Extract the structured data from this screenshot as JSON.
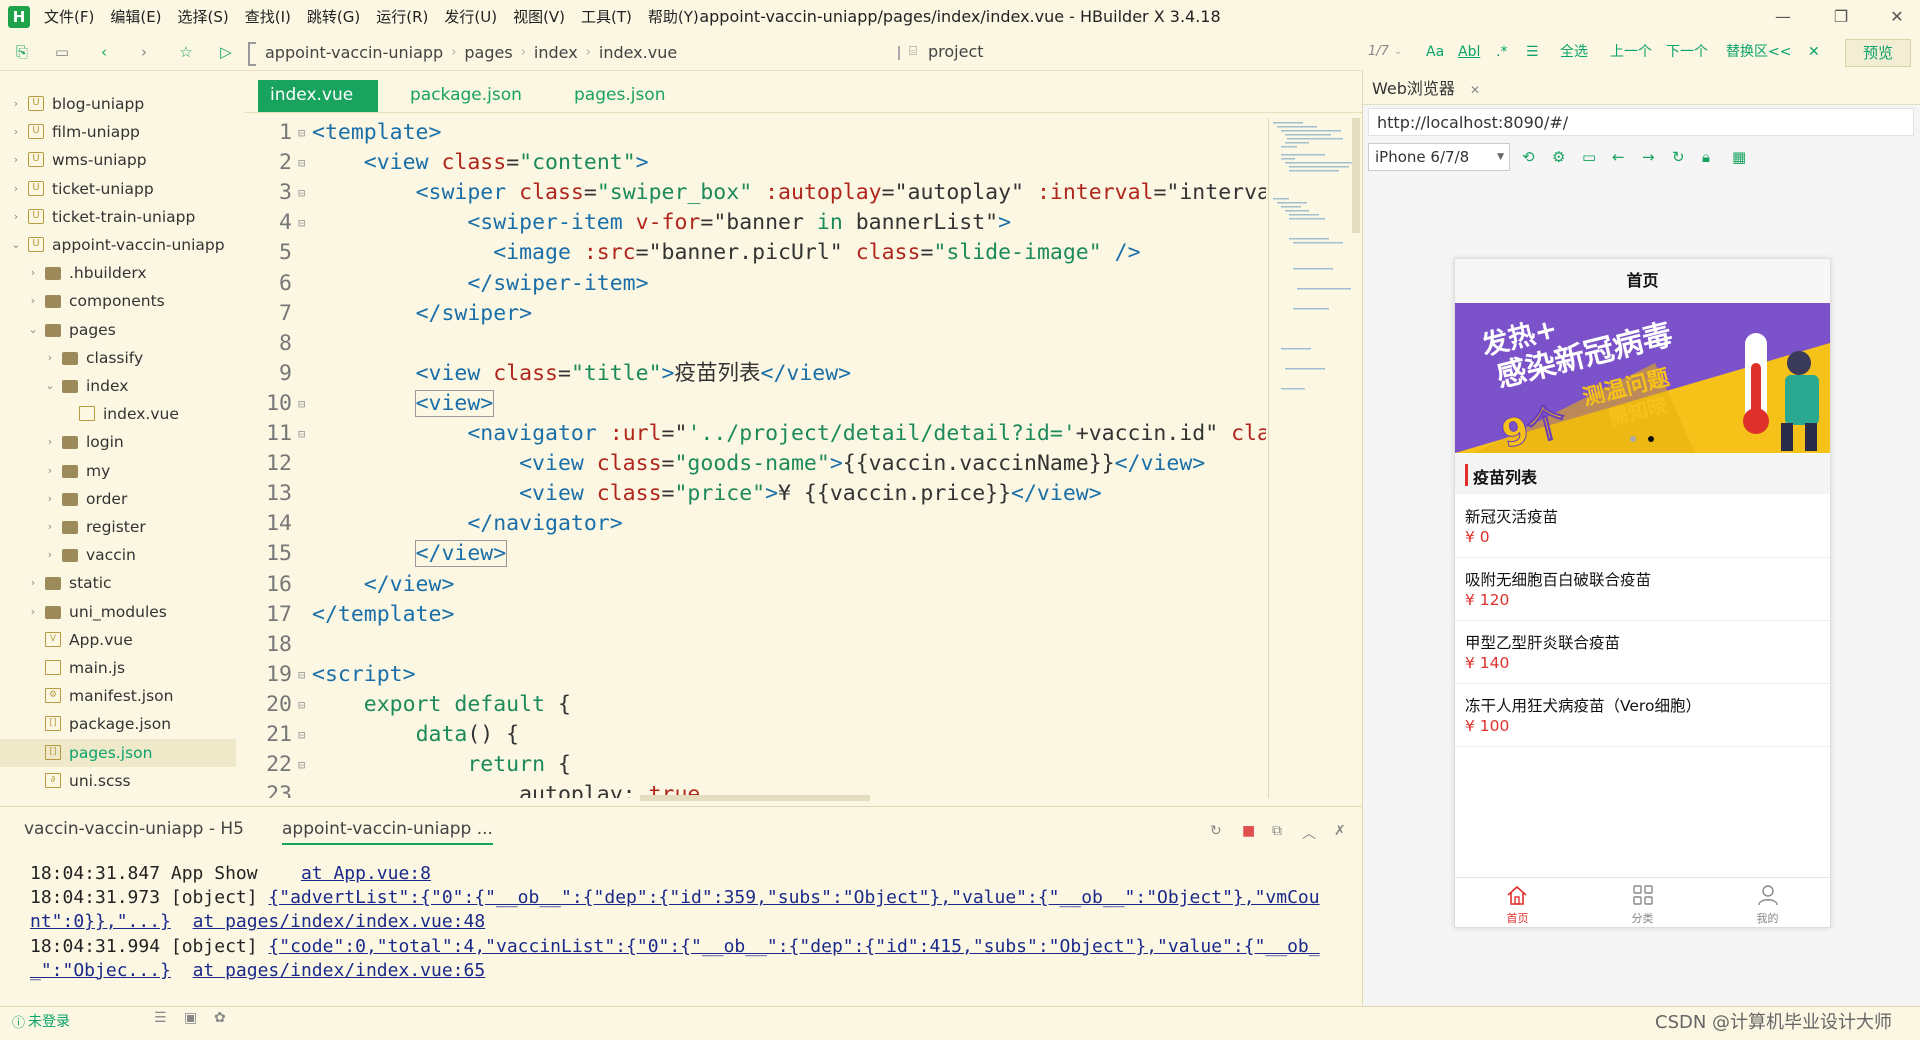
{
  "menu": {
    "items": [
      "文件(F)",
      "编辑(E)",
      "选择(S)",
      "查找(I)",
      "跳转(G)",
      "运行(R)",
      "发行(U)",
      "视图(V)",
      "工具(T)",
      "帮助(Y)"
    ],
    "window_title": "appoint-vaccin-uniapp/pages/index/index.vue - HBuilder X 3.4.18",
    "logo": "H"
  },
  "toolbar": {
    "breadcrumb": [
      "appoint-vaccin-uniapp",
      "pages",
      "index",
      "index.vue"
    ],
    "project": "project",
    "find_counter": "1/7",
    "find_case": "Aa",
    "find_word": "Abl",
    "find_buttons": [
      "全选",
      "上一个",
      "下一个",
      "替换区<<"
    ],
    "preview_label": "预览"
  },
  "sidebar": {
    "items": [
      {
        "label": "blog-uniapp",
        "type": "project",
        "indent": 0,
        "chev": "›"
      },
      {
        "label": "film-uniapp",
        "type": "project",
        "indent": 0,
        "chev": "›"
      },
      {
        "label": "wms-uniapp",
        "type": "project",
        "indent": 0,
        "chev": "›"
      },
      {
        "label": "ticket-uniapp",
        "type": "project",
        "indent": 0,
        "chev": "›"
      },
      {
        "label": "ticket-train-uniapp",
        "type": "project",
        "indent": 0,
        "chev": "›"
      },
      {
        "label": "appoint-vaccin-uniapp",
        "type": "project",
        "indent": 0,
        "chev": "⌄"
      },
      {
        "label": ".hbuilderx",
        "type": "folder",
        "indent": 1,
        "chev": "›"
      },
      {
        "label": "components",
        "type": "folder",
        "indent": 1,
        "chev": "›"
      },
      {
        "label": "pages",
        "type": "folder",
        "indent": 1,
        "chev": "⌄"
      },
      {
        "label": "classify",
        "type": "folder",
        "indent": 2,
        "chev": "›"
      },
      {
        "label": "index",
        "type": "folder",
        "indent": 2,
        "chev": "⌄"
      },
      {
        "label": "index.vue",
        "type": "file",
        "indent": 3,
        "chev": ""
      },
      {
        "label": "login",
        "type": "folder",
        "indent": 2,
        "chev": "›"
      },
      {
        "label": "my",
        "type": "folder",
        "indent": 2,
        "chev": "›"
      },
      {
        "label": "order",
        "type": "folder",
        "indent": 2,
        "chev": "›"
      },
      {
        "label": "register",
        "type": "folder",
        "indent": 2,
        "chev": "›"
      },
      {
        "label": "vaccin",
        "type": "folder",
        "indent": 2,
        "chev": "›"
      },
      {
        "label": "static",
        "type": "folder",
        "indent": 1,
        "chev": "›"
      },
      {
        "label": "uni_modules",
        "type": "folder",
        "indent": 1,
        "chev": "›"
      },
      {
        "label": "App.vue",
        "type": "file",
        "indent": 1,
        "chev": "",
        "glyph": "V"
      },
      {
        "label": "main.js",
        "type": "file",
        "indent": 1,
        "chev": ""
      },
      {
        "label": "manifest.json",
        "type": "file",
        "indent": 1,
        "chev": "",
        "glyph": "⚙"
      },
      {
        "label": "package.json",
        "type": "file",
        "indent": 1,
        "chev": "",
        "glyph": "[]"
      },
      {
        "label": "pages.json",
        "type": "file",
        "indent": 1,
        "chev": "",
        "glyph": "[]",
        "selected": true
      },
      {
        "label": "uni.scss",
        "type": "file",
        "indent": 1,
        "chev": "",
        "glyph": "∂"
      }
    ]
  },
  "editor": {
    "tabs": [
      "index.vue",
      "package.json",
      "pages.json"
    ],
    "active_tab": 0,
    "lines": [
      {
        "n": "1",
        "fold": "⊟",
        "html": "<span class=\"tag\">&lt;template&gt;</span>"
      },
      {
        "n": "2",
        "fold": "⊟",
        "html": "    <span class=\"tag\">&lt;view</span> <span class=\"attr\">class</span>=<span class=\"str\">\"content\"</span><span class=\"tag\">&gt;</span>"
      },
      {
        "n": "3",
        "fold": "⊟",
        "html": "        <span class=\"tag\">&lt;swiper</span> <span class=\"attr\">class</span>=<span class=\"str\">\"swiper_box\"</span> <span class=\"attr\">:autoplay</span>=<span class=\"txt\">\"autoplay\"</span> <span class=\"attr\">:interval</span>=<span class=\"txt\">\"interval\"</span>"
      },
      {
        "n": "4",
        "fold": "⊟",
        "html": "            <span class=\"tag\">&lt;swiper-item</span> <span class=\"attr\">v-for</span>=<span class=\"txt\">\"banner <span class=\"kw\">in</span> bannerList\"</span><span class=\"tag\">&gt;</span>"
      },
      {
        "n": "5",
        "fold": "",
        "html": "              <span class=\"tag\">&lt;image</span> <span class=\"attr\">:src</span>=<span class=\"txt\">\"banner.picUrl\"</span> <span class=\"attr\">class</span>=<span class=\"str\">\"slide-image\"</span> <span class=\"tag\">/&gt;</span>"
      },
      {
        "n": "6",
        "fold": "",
        "html": "            <span class=\"tag\">&lt;/swiper-item&gt;</span>"
      },
      {
        "n": "7",
        "fold": "",
        "html": "        <span class=\"tag\">&lt;/swiper&gt;</span>"
      },
      {
        "n": "8",
        "fold": "",
        "html": ""
      },
      {
        "n": "9",
        "fold": "",
        "html": "        <span class=\"tag\">&lt;view</span> <span class=\"attr\">class</span>=<span class=\"str\">\"title\"</span><span class=\"tag\">&gt;</span><span class=\"txt\">疫苗列表</span><span class=\"tag\">&lt;/view&gt;</span>"
      },
      {
        "n": "10",
        "fold": "⊟",
        "html": "        <span class=\"tag bracket-hl\">&lt;view&gt;</span>"
      },
      {
        "n": "11",
        "fold": "⊟",
        "html": "            <span class=\"tag\">&lt;navigator</span> <span class=\"attr\">:url</span>=<span class=\"txt\">\"<span class=\"str\">'../project/detail/detail?id='</span>+vaccin.id\"</span> <span class=\"attr\">class</span>"
      },
      {
        "n": "12",
        "fold": "",
        "html": "                <span class=\"tag\">&lt;view</span> <span class=\"attr\">class</span>=<span class=\"str\">\"goods-name\"</span><span class=\"tag\">&gt;</span><span class=\"txt\">{{vaccin.vaccinName}}</span><span class=\"tag\">&lt;/view&gt;</span>"
      },
      {
        "n": "13",
        "fold": "",
        "html": "                <span class=\"tag\">&lt;view</span> <span class=\"attr\">class</span>=<span class=\"str\">\"price\"</span><span class=\"tag\">&gt;</span><span class=\"txt\">¥ {{vaccin.price}}</span><span class=\"tag\">&lt;/view&gt;</span>"
      },
      {
        "n": "14",
        "fold": "",
        "html": "            <span class=\"tag\">&lt;/navigator&gt;</span>"
      },
      {
        "n": "15",
        "fold": "",
        "html": "        <span class=\"tag bracket-hl\">&lt;/view&gt;</span>"
      },
      {
        "n": "16",
        "fold": "",
        "html": "    <span class=\"tag\">&lt;/view&gt;</span>"
      },
      {
        "n": "17",
        "fold": "",
        "html": "<span class=\"tag\">&lt;/template&gt;</span>"
      },
      {
        "n": "18",
        "fold": "",
        "html": ""
      },
      {
        "n": "19",
        "fold": "⊟",
        "html": "<span class=\"tag\">&lt;script&gt;</span>"
      },
      {
        "n": "20",
        "fold": "⊟",
        "html": "    <span class=\"kw\">export default</span> <span class=\"txt\">{</span>"
      },
      {
        "n": "21",
        "fold": "⊟",
        "html": "        <span class=\"kw\">data</span><span class=\"txt\">() {</span>"
      },
      {
        "n": "22",
        "fold": "⊟",
        "html": "            <span class=\"kw\">return</span> <span class=\"txt\">{</span>"
      },
      {
        "n": "23",
        "fold": "",
        "html": "                <span class=\"txt\">autoplay: </span><span class=\"attr\">true</span><span class=\"txt\">,</span>"
      }
    ]
  },
  "console": {
    "tabs": [
      "vaccin-vaccin-uniapp - H5",
      "appoint-vaccin-uniapp ..."
    ],
    "logs": [
      {
        "text": "18:04:31.847 App Show  ",
        "link1": "",
        "link2": "at App.vue:8"
      },
      {
        "text": "18:04:31.973 [object] ",
        "link1": "{\"advertList\":{\"0\":{\"__ob__\":{\"dep\":{\"id\":359,\"subs\":\"Object\"},\"value\":{\"__ob__\":\"Object\"},\"vmCou",
        "link2": ""
      },
      {
        "text": "",
        "link1": "nt\":0}},\"...}",
        "link2": "  at pages/index/index.vue:48"
      },
      {
        "text": "18:04:31.994 [object] ",
        "link1": "{\"code\":0,\"total\":4,\"vaccinList\":{\"0\":{\"__ob__\":{\"dep\":{\"id\":415,\"subs\":\"Object\"},\"value\":{\"__ob_",
        "link2": ""
      },
      {
        "text": "",
        "link1": "_\":\"Objec...}",
        "link2": "  at pages/index/index.vue:65"
      }
    ]
  },
  "status": {
    "login": "未登录",
    "watermark": "CSDN @计算机毕业设计大师"
  },
  "browser": {
    "tab_label": "Web浏览器",
    "url": "http://localhost:8090/#/",
    "device": "iPhone 6/7/8"
  },
  "phone": {
    "nav_title": "首页",
    "banner_line1": "发热+",
    "banner_line2": "感染新冠病毒",
    "banner_big": "9个",
    "banner_line3": "测温问题",
    "banner_line4": "需知晓",
    "section_title": "疫苗列表",
    "vaccines": [
      {
        "name": "新冠灭活疫苗",
        "price": "¥ 0"
      },
      {
        "name": "吸附无细胞百白破联合疫苗",
        "price": "¥ 120"
      },
      {
        "name": "甲型乙型肝炎联合疫苗",
        "price": "¥ 140"
      },
      {
        "name": "冻干人用狂犬病疫苗（Vero细胞）",
        "price": "¥ 100"
      }
    ],
    "tabs": [
      "首页",
      "分类",
      "我的"
    ],
    "active_tab": 0
  },
  "colors": {
    "accent": "#18a35e",
    "price_red": "#e0302b",
    "banner_purple": "#7b52c9",
    "banner_yellow": "#f6c21a"
  }
}
